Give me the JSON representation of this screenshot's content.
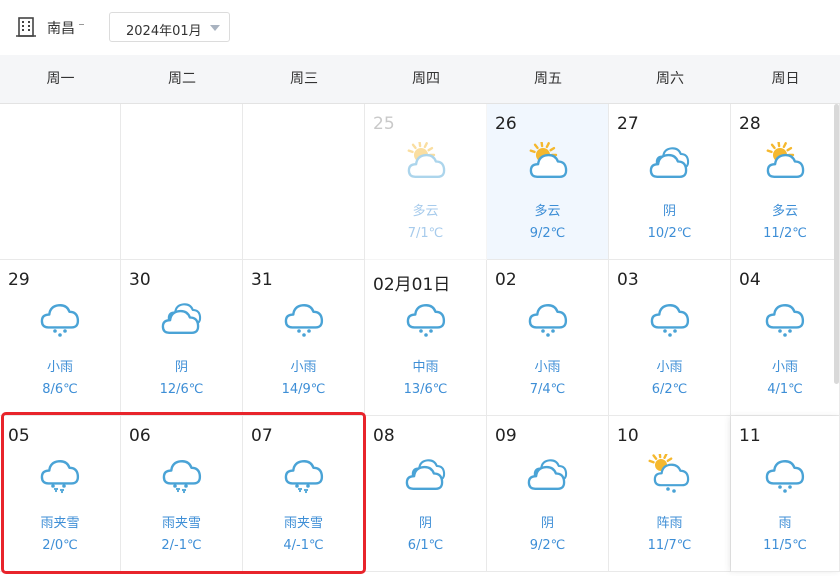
{
  "header": {
    "city": "南昌",
    "month": "2024年01月"
  },
  "weekdays": [
    "周一",
    "周二",
    "周三",
    "周四",
    "周五",
    "周六",
    "周日"
  ],
  "weeks": [
    [
      {
        "empty": true
      },
      {
        "empty": true
      },
      {
        "empty": true
      },
      {
        "date": "25",
        "icon": "partly-cloudy-icon",
        "condition": "多云",
        "temp": "7/1℃",
        "faded": true
      },
      {
        "date": "26",
        "icon": "partly-cloudy-icon",
        "condition": "多云",
        "temp": "9/2℃",
        "today": true
      },
      {
        "date": "27",
        "icon": "overcast-icon",
        "condition": "阴",
        "temp": "10/2℃"
      },
      {
        "date": "28",
        "icon": "partly-cloudy-icon",
        "condition": "多云",
        "temp": "11/2℃"
      }
    ],
    [
      {
        "date": "29",
        "icon": "light-rain-icon",
        "condition": "小雨",
        "temp": "8/6℃"
      },
      {
        "date": "30",
        "icon": "overcast-icon",
        "condition": "阴",
        "temp": "12/6℃"
      },
      {
        "date": "31",
        "icon": "light-rain-icon",
        "condition": "小雨",
        "temp": "14/9℃"
      },
      {
        "date": "02月01日",
        "icon": "light-rain-icon",
        "condition": "中雨",
        "temp": "13/6℃"
      },
      {
        "date": "02",
        "icon": "light-rain-icon",
        "condition": "小雨",
        "temp": "7/4℃"
      },
      {
        "date": "03",
        "icon": "light-rain-icon",
        "condition": "小雨",
        "temp": "6/2℃"
      },
      {
        "date": "04",
        "icon": "light-rain-icon",
        "condition": "小雨",
        "temp": "4/1℃"
      }
    ],
    [
      {
        "date": "05",
        "icon": "sleet-icon",
        "condition": "雨夹雪",
        "temp": "2/0℃"
      },
      {
        "date": "06",
        "icon": "sleet-icon",
        "condition": "雨夹雪",
        "temp": "2/-1℃"
      },
      {
        "date": "07",
        "icon": "sleet-icon",
        "condition": "雨夹雪",
        "temp": "4/-1℃"
      },
      {
        "date": "08",
        "icon": "overcast-icon",
        "condition": "阴",
        "temp": "6/1℃"
      },
      {
        "date": "09",
        "icon": "overcast-icon",
        "condition": "阴",
        "temp": "9/2℃"
      },
      {
        "date": "10",
        "icon": "shower-icon",
        "condition": "阵雨",
        "temp": "11/7℃"
      },
      {
        "date": "11",
        "icon": "rain-icon",
        "condition": "雨",
        "temp": "11/5℃",
        "shadow": true
      }
    ]
  ],
  "colors": {
    "accent": "#3d8ed6",
    "cloud_stroke": "#4aa3d6",
    "sun": "#f5b82e",
    "highlight": "#e8242b",
    "today_bg": "#f1f7fe"
  }
}
